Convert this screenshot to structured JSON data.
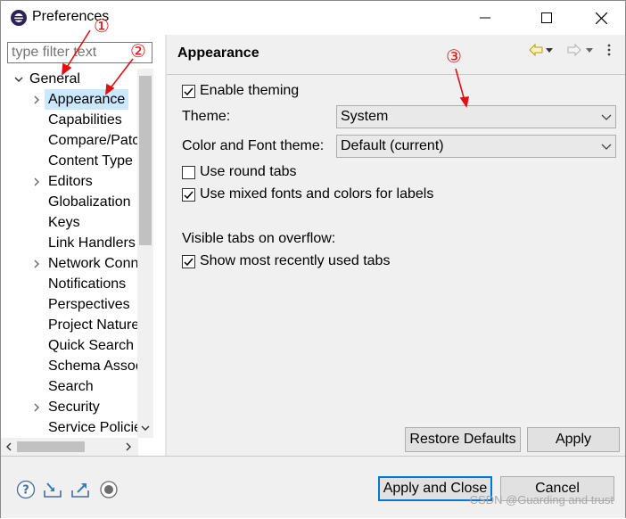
{
  "window": {
    "title": "Preferences"
  },
  "filter": {
    "placeholder": "type filter text"
  },
  "tree": {
    "root_label": "General",
    "items": [
      {
        "label": "Appearance",
        "expandable": true,
        "selected": true
      },
      {
        "label": "Capabilities",
        "expandable": false
      },
      {
        "label": "Compare/Patc",
        "expandable": false
      },
      {
        "label": "Content Type",
        "expandable": false
      },
      {
        "label": "Editors",
        "expandable": true
      },
      {
        "label": "Globalization",
        "expandable": false
      },
      {
        "label": "Keys",
        "expandable": false
      },
      {
        "label": "Link Handlers",
        "expandable": false
      },
      {
        "label": "Network Conn",
        "expandable": true
      },
      {
        "label": "Notifications",
        "expandable": false
      },
      {
        "label": "Perspectives",
        "expandable": false
      },
      {
        "label": "Project Nature",
        "expandable": false
      },
      {
        "label": "Quick Search",
        "expandable": false
      },
      {
        "label": "Schema Assoc",
        "expandable": false
      },
      {
        "label": "Search",
        "expandable": false
      },
      {
        "label": "Security",
        "expandable": true
      },
      {
        "label": "Service Policie",
        "expandable": false
      }
    ]
  },
  "page": {
    "title": "Appearance",
    "enable_theming": {
      "label": "Enable theming",
      "checked": true
    },
    "theme": {
      "label": "Theme:",
      "value": "System"
    },
    "color_font_theme": {
      "label": "Color and Font theme:",
      "value": "Default (current)"
    },
    "round_tabs": {
      "label": "Use round tabs",
      "checked": false
    },
    "mixed_fonts": {
      "label": "Use mixed fonts and colors for labels",
      "checked": true
    },
    "visible_tabs_label": "Visible tabs on overflow:",
    "recent_tabs": {
      "label": "Show most recently used tabs",
      "checked": true
    },
    "restore_defaults": "Restore Defaults",
    "apply": "Apply"
  },
  "footer": {
    "apply_close": "Apply and Close",
    "cancel": "Cancel"
  },
  "annotations": {
    "one": "①",
    "two": "②",
    "three": "③"
  },
  "watermark": "CSDN @Guarding and trust",
  "colors": {
    "selection": "#cce8ff",
    "annotation": "#e01010",
    "accent": "#0078d7"
  },
  "icons": {
    "help": "help-icon",
    "import": "import-icon",
    "export": "export-icon",
    "record": "record-icon"
  }
}
